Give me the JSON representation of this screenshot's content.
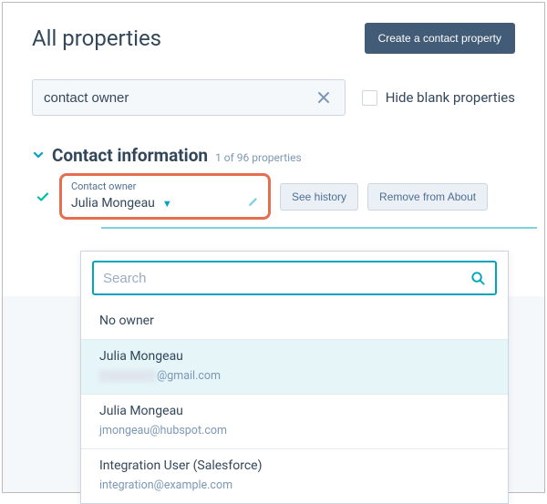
{
  "header": {
    "title": "All properties",
    "create_label": "Create a contact property"
  },
  "filter": {
    "search_value": "contact owner",
    "hide_blank_label": "Hide blank properties"
  },
  "section": {
    "title": "Contact information",
    "count_label": "1 of 96 properties"
  },
  "property": {
    "label": "Contact owner",
    "value": "Julia Mongeau",
    "see_history_label": "See history",
    "remove_label": "Remove from About"
  },
  "dropdown": {
    "search_placeholder": "Search",
    "items": [
      {
        "name": "No owner",
        "email": ""
      },
      {
        "name": "Julia Mongeau",
        "email_suffix": "@gmail.com",
        "redacted_prefix": true,
        "selected": true
      },
      {
        "name": "Julia Mongeau",
        "email": "jmongeau@hubspot.com"
      },
      {
        "name": "Integration User (Salesforce)",
        "email": "integration@example.com"
      }
    ]
  }
}
